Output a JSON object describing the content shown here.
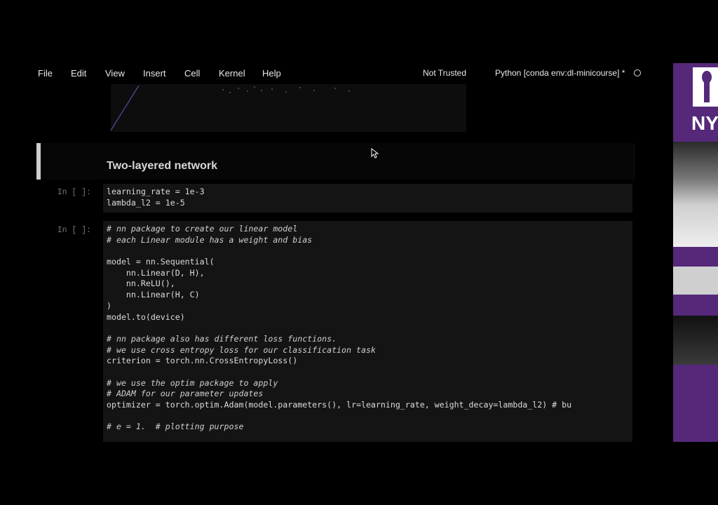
{
  "menu": {
    "items": [
      "File",
      "Edit",
      "View",
      "Insert",
      "Cell",
      "Kernel",
      "Help"
    ],
    "trust_status": "Not Trusted",
    "kernel_name": "Python [conda env:dl-minicourse] *"
  },
  "markdown_cell": {
    "heading": "Two-layered network"
  },
  "cells": [
    {
      "prompt": "In [ ]:",
      "lines": [
        {
          "text": "learning_rate = 1e-3",
          "comment": false
        },
        {
          "text": "lambda_l2 = 1e-5",
          "comment": false
        }
      ]
    },
    {
      "prompt": "In [ ]:",
      "lines": [
        {
          "text": "# nn package to create our linear model",
          "comment": true
        },
        {
          "text": "# each Linear module has a weight and bias",
          "comment": true
        },
        {
          "text": "",
          "comment": false
        },
        {
          "text": "model = nn.Sequential(",
          "comment": false
        },
        {
          "text": "    nn.Linear(D, H),",
          "comment": false
        },
        {
          "text": "    nn.ReLU(),",
          "comment": false
        },
        {
          "text": "    nn.Linear(H, C)",
          "comment": false
        },
        {
          "text": ")",
          "comment": false
        },
        {
          "text": "model.to(device)",
          "comment": false
        },
        {
          "text": "",
          "comment": false
        },
        {
          "text": "# nn package also has different loss functions.",
          "comment": true
        },
        {
          "text": "# we use cross entropy loss for our classification task",
          "comment": true
        },
        {
          "text": "criterion = torch.nn.CrossEntropyLoss()",
          "comment": false
        },
        {
          "text": "",
          "comment": false
        },
        {
          "text": "# we use the optim package to apply",
          "comment": true
        },
        {
          "text": "# ADAM for our parameter updates",
          "comment": true
        },
        {
          "text": "optimizer = torch.optim.Adam(model.parameters(), lr=learning_rate, weight_decay=lambda_l2) # bu",
          "comment": false
        },
        {
          "text": "",
          "comment": false
        },
        {
          "text": "# e = 1.  # plotting purpose",
          "comment": true
        }
      ]
    }
  ],
  "logo": {
    "text": "NY"
  },
  "colors": {
    "background": "#000000",
    "code_cell": "#141414",
    "markdown_bar": "#cfcfcf",
    "nyu_purple": "#55287a"
  }
}
